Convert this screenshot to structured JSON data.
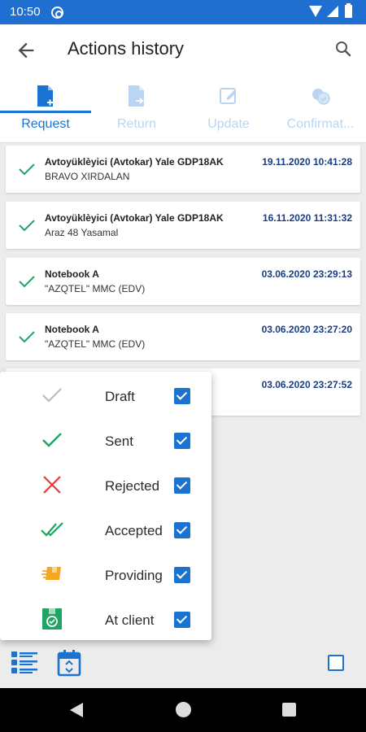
{
  "status_bar": {
    "time": "10:50"
  },
  "app_bar": {
    "title": "Actions history"
  },
  "tabs": [
    {
      "label": "Request",
      "icon": "request-doc-icon",
      "active": true
    },
    {
      "label": "Return",
      "icon": "return-doc-icon",
      "active": false
    },
    {
      "label": "Update",
      "icon": "edit-icon",
      "active": false
    },
    {
      "label": "Confirmat...",
      "icon": "confirmation-icon",
      "active": false
    }
  ],
  "list": {
    "items": [
      {
        "title": "Avtoyüklèyici (Avtokar) Yale GDP18AK",
        "subtitle": "BRAVO XIRDALAN",
        "date": "19.11.2020 10:41:28",
        "status_icon": "check-icon"
      },
      {
        "title": "Avtoyüklèyici (Avtokar) Yale GDP18AK",
        "subtitle": "Araz 48 Yasamal",
        "date": "16.11.2020 11:31:32",
        "status_icon": "check-icon"
      },
      {
        "title": "Notebook A",
        "subtitle": " \"AZQTEL\" MMC (EDV)",
        "date": "03.06.2020 23:29:13",
        "status_icon": "check-icon"
      },
      {
        "title": "Notebook A",
        "subtitle": " \"AZQTEL\" MMC (EDV)",
        "date": "03.06.2020 23:27:20",
        "status_icon": "check-icon"
      },
      {
        "title": "",
        "subtitle": "",
        "date": "03.06.2020 23:27:52",
        "status_icon": "check-icon"
      }
    ]
  },
  "filter_menu": {
    "options": [
      {
        "label": "Draft",
        "icon": "draft-check-icon",
        "checked": true
      },
      {
        "label": "Sent",
        "icon": "sent-check-icon",
        "checked": true
      },
      {
        "label": "Rejected",
        "icon": "rejected-x-icon",
        "checked": true
      },
      {
        "label": "Accepted",
        "icon": "accepted-double-check-icon",
        "checked": true
      },
      {
        "label": "Providing",
        "icon": "providing-truck-icon",
        "checked": true
      },
      {
        "label": "At client",
        "icon": "at-client-icon",
        "checked": true
      }
    ]
  },
  "bottom_bar": {
    "select_all_checked": false
  },
  "colors": {
    "status_bar": "#1f6fd1",
    "accent": "#1b73d1",
    "tab_inactive": "#b9d5f2",
    "date_text": "#1a3c83",
    "check_green": "#1fa463",
    "reject_red": "#e53935",
    "providing_orange": "#f5a623",
    "draft_gray": "#bdbdbd"
  }
}
